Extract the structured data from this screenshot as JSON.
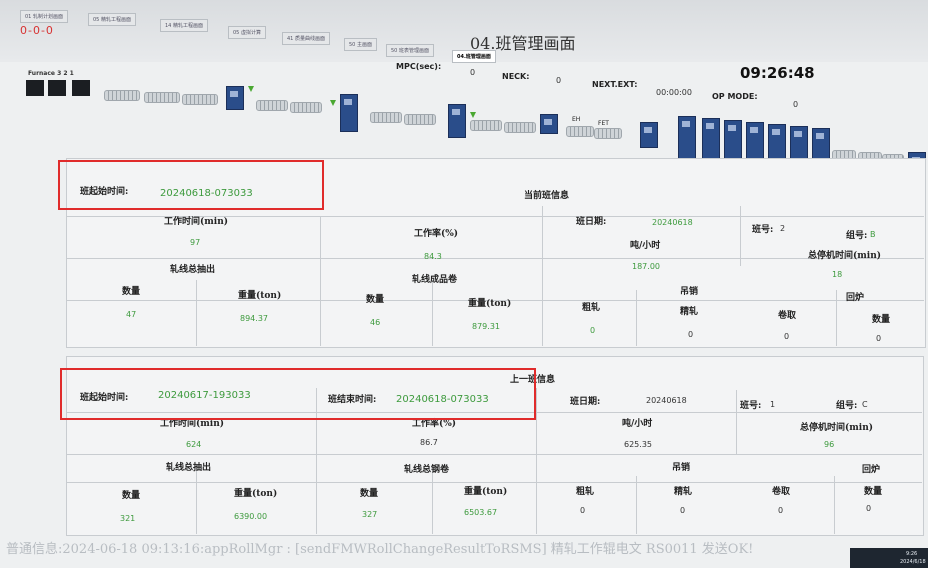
{
  "header": {
    "status_text": "0-0-0",
    "tabs": [
      "01 轧制计划画面",
      "05 精轧工程画面",
      "14 精轧工程画面",
      "05 虚拟计算",
      "41 质量曲线画面",
      "50 主画面",
      "50 班表管理画面",
      "04.班管理画面"
    ],
    "active_tab": "04.班管理画面",
    "page_title": "04.班管理画面",
    "clock": "09:26:48",
    "mpc_label": "MPC(sec):",
    "mpc_value": "0",
    "neck_label": "NECK:",
    "neck_value": "0",
    "next_ext_label": "NEXT.EXT:",
    "next_ext_value": "00:00:00",
    "op_mode_label": "OP MODE:",
    "op_mode_value": "0"
  },
  "mill_line": {
    "furnace_label": "Furnace 3 2 1",
    "labels": {
      "eh": "EH",
      "fet": "FET"
    }
  },
  "current_shift": {
    "section_title": "当前班信息",
    "start_label": "班起始时间:",
    "start_value": "20240618-073033",
    "date_label": "班日期:",
    "date_value": "20240618",
    "shift_label": "班号:",
    "shift_value": "2",
    "group_label": "组号:",
    "group_value": "B",
    "work_time_label": "工作时间(min)",
    "work_time_value": "97",
    "work_rate_label": "工作率(%)",
    "work_rate_value": "84.3",
    "tph_label": "吨/小时",
    "tph_value": "187.00",
    "stop_label": "总停机时间(min)",
    "stop_value": "18",
    "extract_label": "轧线总抽出",
    "finish_label": "轧线成品卷",
    "qty_label": "数量",
    "weight_label": "重量(ton)",
    "extract_qty": "47",
    "extract_weight": "894.37",
    "finish_qty": "46",
    "finish_weight": "879.31",
    "scrap_label": "吊销",
    "rough_label": "粗轧",
    "rough_value": "0",
    "fine_label": "精轧",
    "fine_value": "0",
    "coil_label": "卷取",
    "coil_value": "0",
    "return_label": "回炉",
    "return_qty_label": "数量",
    "return_value": "0"
  },
  "previous_shift": {
    "section_title": "上一班信息",
    "start_label": "班起始时间:",
    "start_value": "20240617-193033",
    "end_label": "班结束时间:",
    "end_value": "20240618-073033",
    "date_label": "班日期:",
    "date_value": "20240618",
    "shift_label": "班号:",
    "shift_value": "1",
    "group_label": "组号:",
    "group_value": "C",
    "work_time_label": "工作时间(min)",
    "work_time_value": "624",
    "work_rate_label": "工作率(%)",
    "work_rate_value": "86.7",
    "tph_label": "吨/小时",
    "tph_value": "625.35",
    "stop_label": "总停机时间(min)",
    "stop_value": "96",
    "extract_label": "轧线总抽出",
    "finish_label": "轧线总钢卷",
    "qty_label": "数量",
    "weight_label": "重量(ton)",
    "extract_qty": "321",
    "extract_weight": "6390.00",
    "finish_qty": "327",
    "finish_weight": "6503.67",
    "scrap_label": "吊销",
    "rough_label": "粗轧",
    "rough_value": "0",
    "fine_label": "精轧",
    "fine_value": "0",
    "coil_label": "卷取",
    "coil_value": "0",
    "return_label": "回炉",
    "return_qty_label": "数量",
    "return_value": "0"
  },
  "status_bar": {
    "message": "普通信息:2024-06-18 09:13:16:appRollMgr : [sendFMWRollChangeResultToRSMS] 精轧工作辊电文 RS0011 发送OK!",
    "tray_time": "9:26",
    "tray_date": "2024/6/18"
  },
  "colors": {
    "value_green": "#3d9a3d",
    "highlight_red": "#e02b2b",
    "equipment_blue": "#2a4d8a"
  }
}
